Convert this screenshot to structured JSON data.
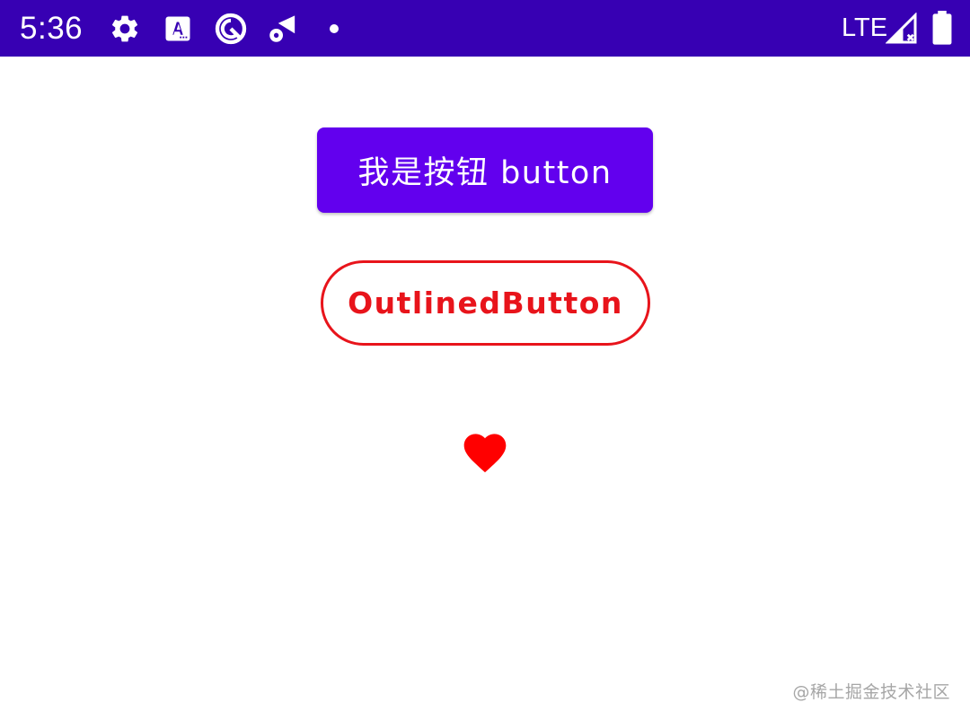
{
  "status_bar": {
    "time": "5:36",
    "network": "LTE",
    "background_color": "#3700b3",
    "icons": [
      "settings-icon",
      "a-notification-icon",
      "data-saver-icon",
      "wifi-settings-icon",
      "notification-dot-icon",
      "signal-icon",
      "battery-icon"
    ]
  },
  "buttons": {
    "filled_label": "我是按钮 button",
    "filled_color": "#6200ee",
    "outlined_label": "OutlinedButton",
    "outlined_color": "#e8141b",
    "heart_icon": "heart-icon",
    "heart_color": "#ff0000"
  },
  "watermark": "@稀土掘金技术社区"
}
